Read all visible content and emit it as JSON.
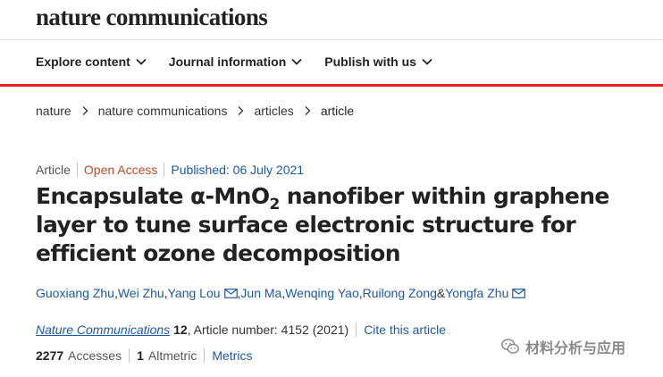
{
  "header": {
    "logo_text": "nature communications"
  },
  "nav": {
    "items": [
      {
        "label": "Explore content"
      },
      {
        "label": "Journal information"
      },
      {
        "label": "Publish with us"
      }
    ]
  },
  "breadcrumb": {
    "items": [
      "nature",
      "nature communications",
      "articles",
      "article"
    ]
  },
  "article": {
    "type": "Article",
    "access": "Open Access",
    "published": "Published: 06 July 2021",
    "title_part1": "Encapsulate α-MnO",
    "title_sub": "2",
    "title_part2": " nanofiber within graphene layer to tune surface electronic structure for efficient ozone decomposition",
    "authors": {
      "a1": "Guoxiang Zhu",
      "sep1": ", ",
      "a2": "Wei Zhu",
      "sep2": ", ",
      "a3": "Yang Lou",
      "sep3": ", ",
      "a4": "Jun Ma",
      "sep4": ", ",
      "a5": "Wenqing Yao",
      "sep5": ", ",
      "a6": "Ruilong Zong",
      "sep6": " & ",
      "a7": "Yongfa Zhu"
    },
    "citation": {
      "journal": "Nature Communications",
      "volume": "12",
      "article_number": ", Article number: 4152 (2021)",
      "cite_link": "Cite this article"
    },
    "metrics": {
      "accesses_value": "2277",
      "accesses_label": "Accesses",
      "altmetric_value": "1",
      "altmetric_label": "Altmetric",
      "metrics_link": "Metrics"
    }
  },
  "watermark": {
    "text": "材料分析与应用",
    "icon": "wechat-icon"
  },
  "colors": {
    "accent_red": "#e2231a",
    "link_blue": "#1b5aa8",
    "open_access": "#c14a2e"
  }
}
